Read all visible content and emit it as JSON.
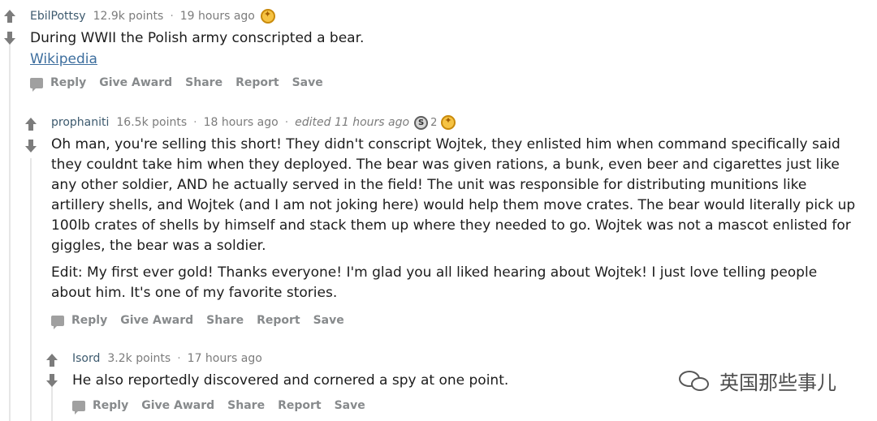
{
  "comments": [
    {
      "author": "EbilPottsy",
      "points": "12.9k points",
      "separator": "·",
      "time": "19 hours ago",
      "body": [
        "During WWII the Polish army conscripted a bear."
      ],
      "link_text": "Wikipedia"
    },
    {
      "author": "prophaniti",
      "points": "16.5k points",
      "separator": "·",
      "time": "18 hours ago",
      "edited": "edited 11 hours ago",
      "silver_icon": "S",
      "award_count": "2",
      "body": [
        "Oh man, you're selling this short! They didn't conscript Wojtek, they enlisted him when command specifically said they couldnt take him when they deployed. The bear was given rations, a bunk, even beer and cigarettes just like any other soldier, AND he actually served in the field! The unit was responsible for distributing munitions like artillery shells, and Wojtek (and I am not joking here) would help them move crates. The bear would literally pick up 100lb crates of shells by himself and stack them up where they needed to go. Wojtek was not a mascot enlisted for giggles, the bear was a soldier.",
        "Edit: My first ever gold! Thanks everyone! I'm glad you all liked hearing about Wojtek! I just love telling people about him. It's one of my favorite stories."
      ]
    },
    {
      "author": "Isord",
      "points": "3.2k points",
      "separator": "·",
      "time": "17 hours ago",
      "body": [
        "He also reportedly discovered and cornered a spy at one point."
      ]
    }
  ],
  "actions": {
    "reply": "Reply",
    "give_award": "Give Award",
    "share": "Share",
    "report": "Report",
    "save": "Save"
  },
  "watermark": {
    "text": "英国那些事儿"
  },
  "icons": {
    "upvote": "arrow-up-icon",
    "downvote": "arrow-down-icon",
    "reply": "comment-bubble-icon",
    "gold_award": "gold-award-icon",
    "silver_award": "silver-award-icon",
    "wechat": "wechat-icon"
  },
  "colors": {
    "author": "#3d5a6e",
    "meta": "#7c7c7c",
    "action": "#878a8c",
    "link": "#3d6e9e",
    "gold": "#f6c343"
  }
}
